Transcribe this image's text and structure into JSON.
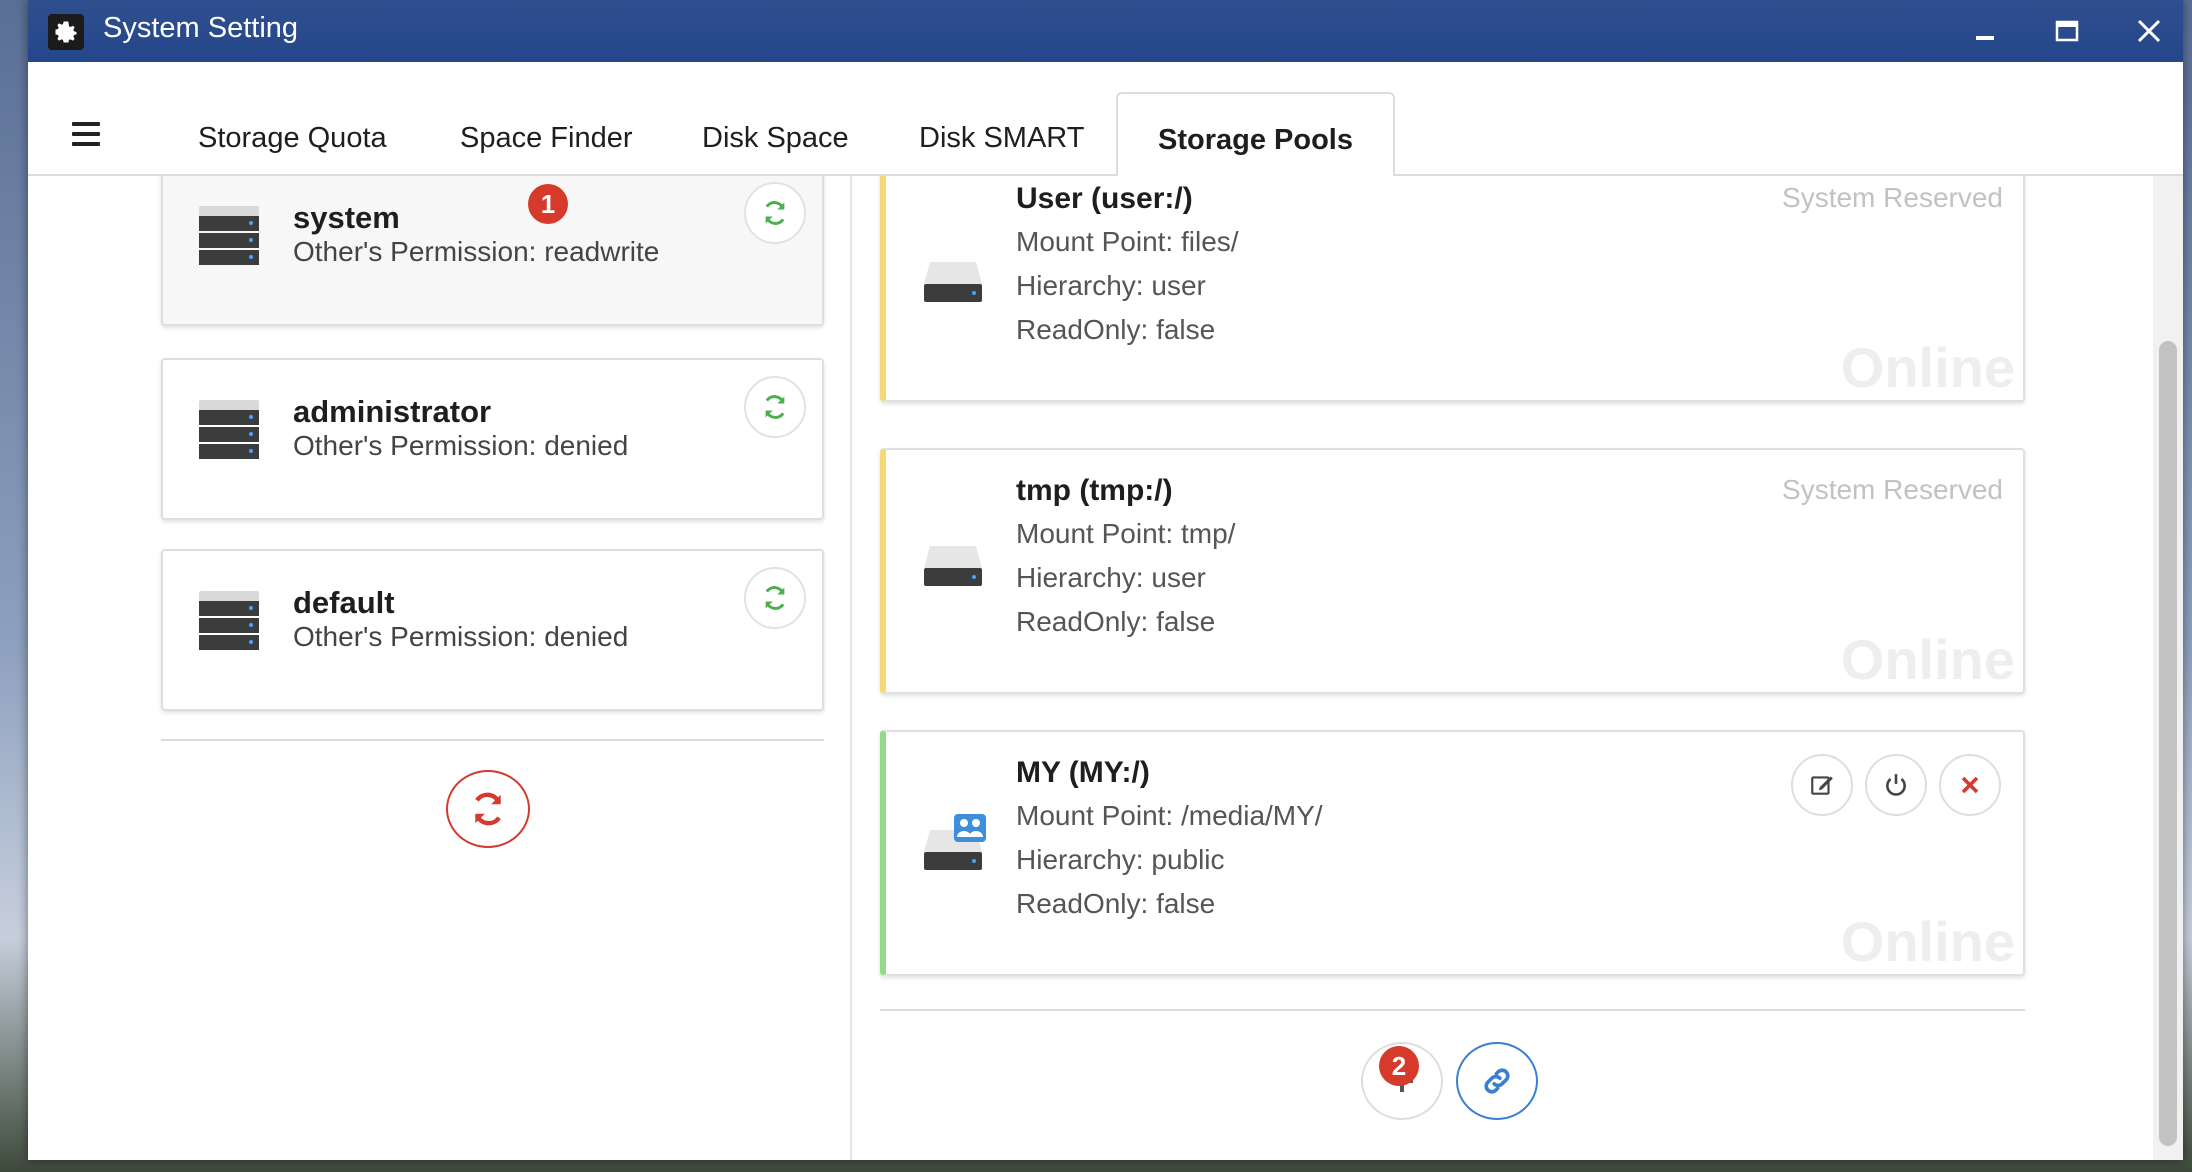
{
  "window": {
    "title": "System Setting"
  },
  "tabs": [
    {
      "label": "Storage Quota"
    },
    {
      "label": "Space Finder"
    },
    {
      "label": "Disk Space"
    },
    {
      "label": "Disk SMART"
    },
    {
      "label": "Storage Pools",
      "active": true
    }
  ],
  "users": [
    {
      "name": "system",
      "permission": "Other's Permission: readwrite"
    },
    {
      "name": "administrator",
      "permission": "Other's Permission: denied"
    },
    {
      "name": "default",
      "permission": "Other's Permission: denied"
    }
  ],
  "badges": {
    "one": "1",
    "two": "2"
  },
  "pools": [
    {
      "name": "User (user:/)",
      "mount": "Mount Point: files/",
      "hierarchy": "Hierarchy: user",
      "readonly": "ReadOnly: false",
      "reserved": "System Reserved",
      "status": "Online"
    },
    {
      "name": "tmp (tmp:/)",
      "mount": "Mount Point: tmp/",
      "hierarchy": "Hierarchy: user",
      "readonly": "ReadOnly: false",
      "reserved": "System Reserved",
      "status": "Online"
    },
    {
      "name": "MY (MY:/)",
      "mount": "Mount Point: /media/MY/",
      "hierarchy": "Hierarchy: public",
      "readonly": "ReadOnly: false",
      "status": "Online"
    }
  ],
  "colors": {
    "titlebar": "#24468a",
    "refresh_green": "#4caf50",
    "danger_red": "#d43a2e",
    "link_blue": "#3a7fd4",
    "reserved_border": "#f4d87a",
    "custom_border": "#95d98b"
  },
  "icons": {
    "app": "gear-icon",
    "minimize": "minimize-icon",
    "maximize": "maximize-icon",
    "close": "close-icon",
    "menu": "hamburger-icon",
    "user": "server-rack-icon",
    "pool": "drive-icon",
    "refresh": "refresh-icon",
    "edit": "edit-icon",
    "power": "power-icon",
    "remove": "x-icon",
    "add": "plus-icon",
    "link": "link-icon"
  }
}
